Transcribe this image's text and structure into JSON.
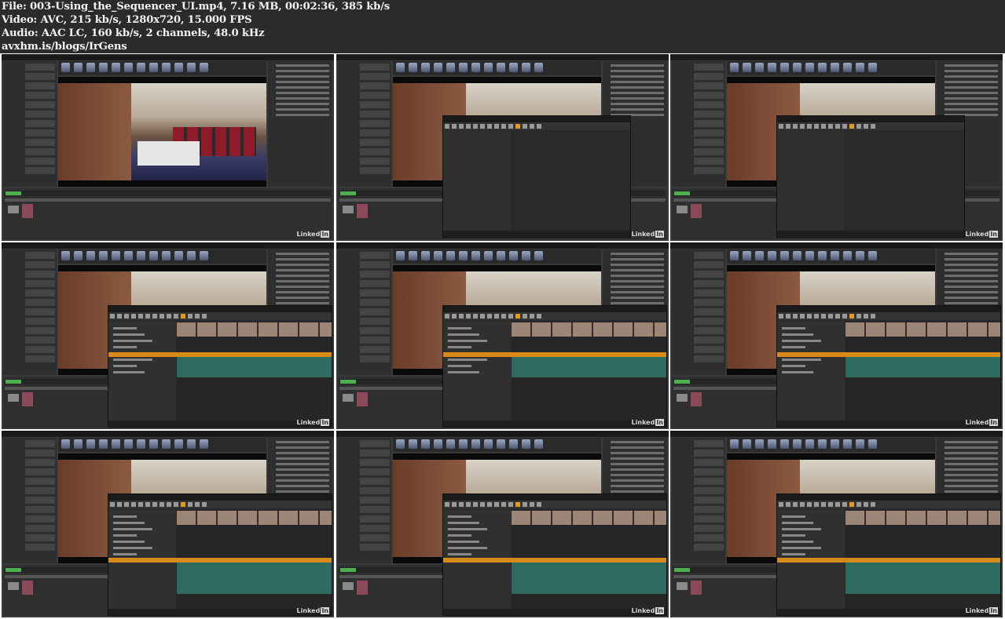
{
  "header": {
    "file_line": "File: 003-Using_the_Sequencer_UI.mp4, 7.16 MB, 00:02:36, 385 kb/s",
    "video_line": "Video: AVC, 215 kb/s, 1280x720, 15.000 FPS",
    "audio_line": "Audio: AAC LC, 160 kb/s, 2 channels, 48.0 kHz",
    "source_line": "avxhm.is/blogs/IrGens"
  },
  "thumbnails": {
    "count": 9,
    "watermark": "LinkedIn"
  },
  "colors": {
    "background": "#2b2b2b",
    "editor": "#3a3a3a",
    "accent_orange": "#d78a15",
    "track_teal": "#2f6a61",
    "add_new_green": "#4caf50"
  }
}
